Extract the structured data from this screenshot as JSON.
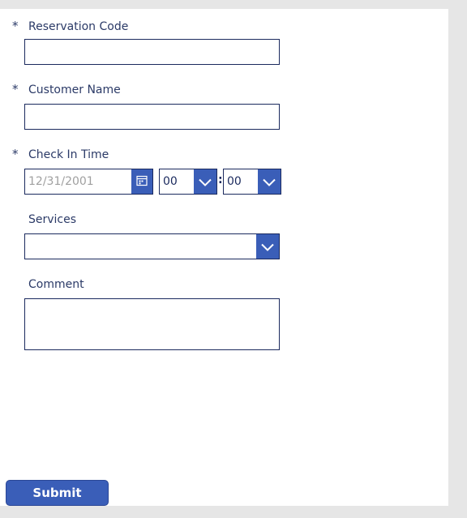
{
  "form": {
    "reservation_code": {
      "required_mark": "*",
      "label": "Reservation Code",
      "value": ""
    },
    "customer_name": {
      "required_mark": "*",
      "label": "Customer Name",
      "value": ""
    },
    "check_in_time": {
      "required_mark": "*",
      "label": "Check In Time",
      "date_placeholder": "12/31/2001",
      "hour": "00",
      "separator": ":",
      "minute": "00"
    },
    "services": {
      "label": "Services",
      "value": ""
    },
    "comment": {
      "label": "Comment",
      "value": ""
    }
  },
  "submit_label": "Submit",
  "colors": {
    "accent": "#3a5eb8",
    "border": "#1b2a5e",
    "label_text": "#2b3a67",
    "placeholder": "#a0a0a0",
    "background": "#e6e6e6",
    "panel": "#ffffff"
  },
  "icons": {
    "date_picker": "calendar-icon",
    "dropdown": "chevron-down-icon"
  }
}
